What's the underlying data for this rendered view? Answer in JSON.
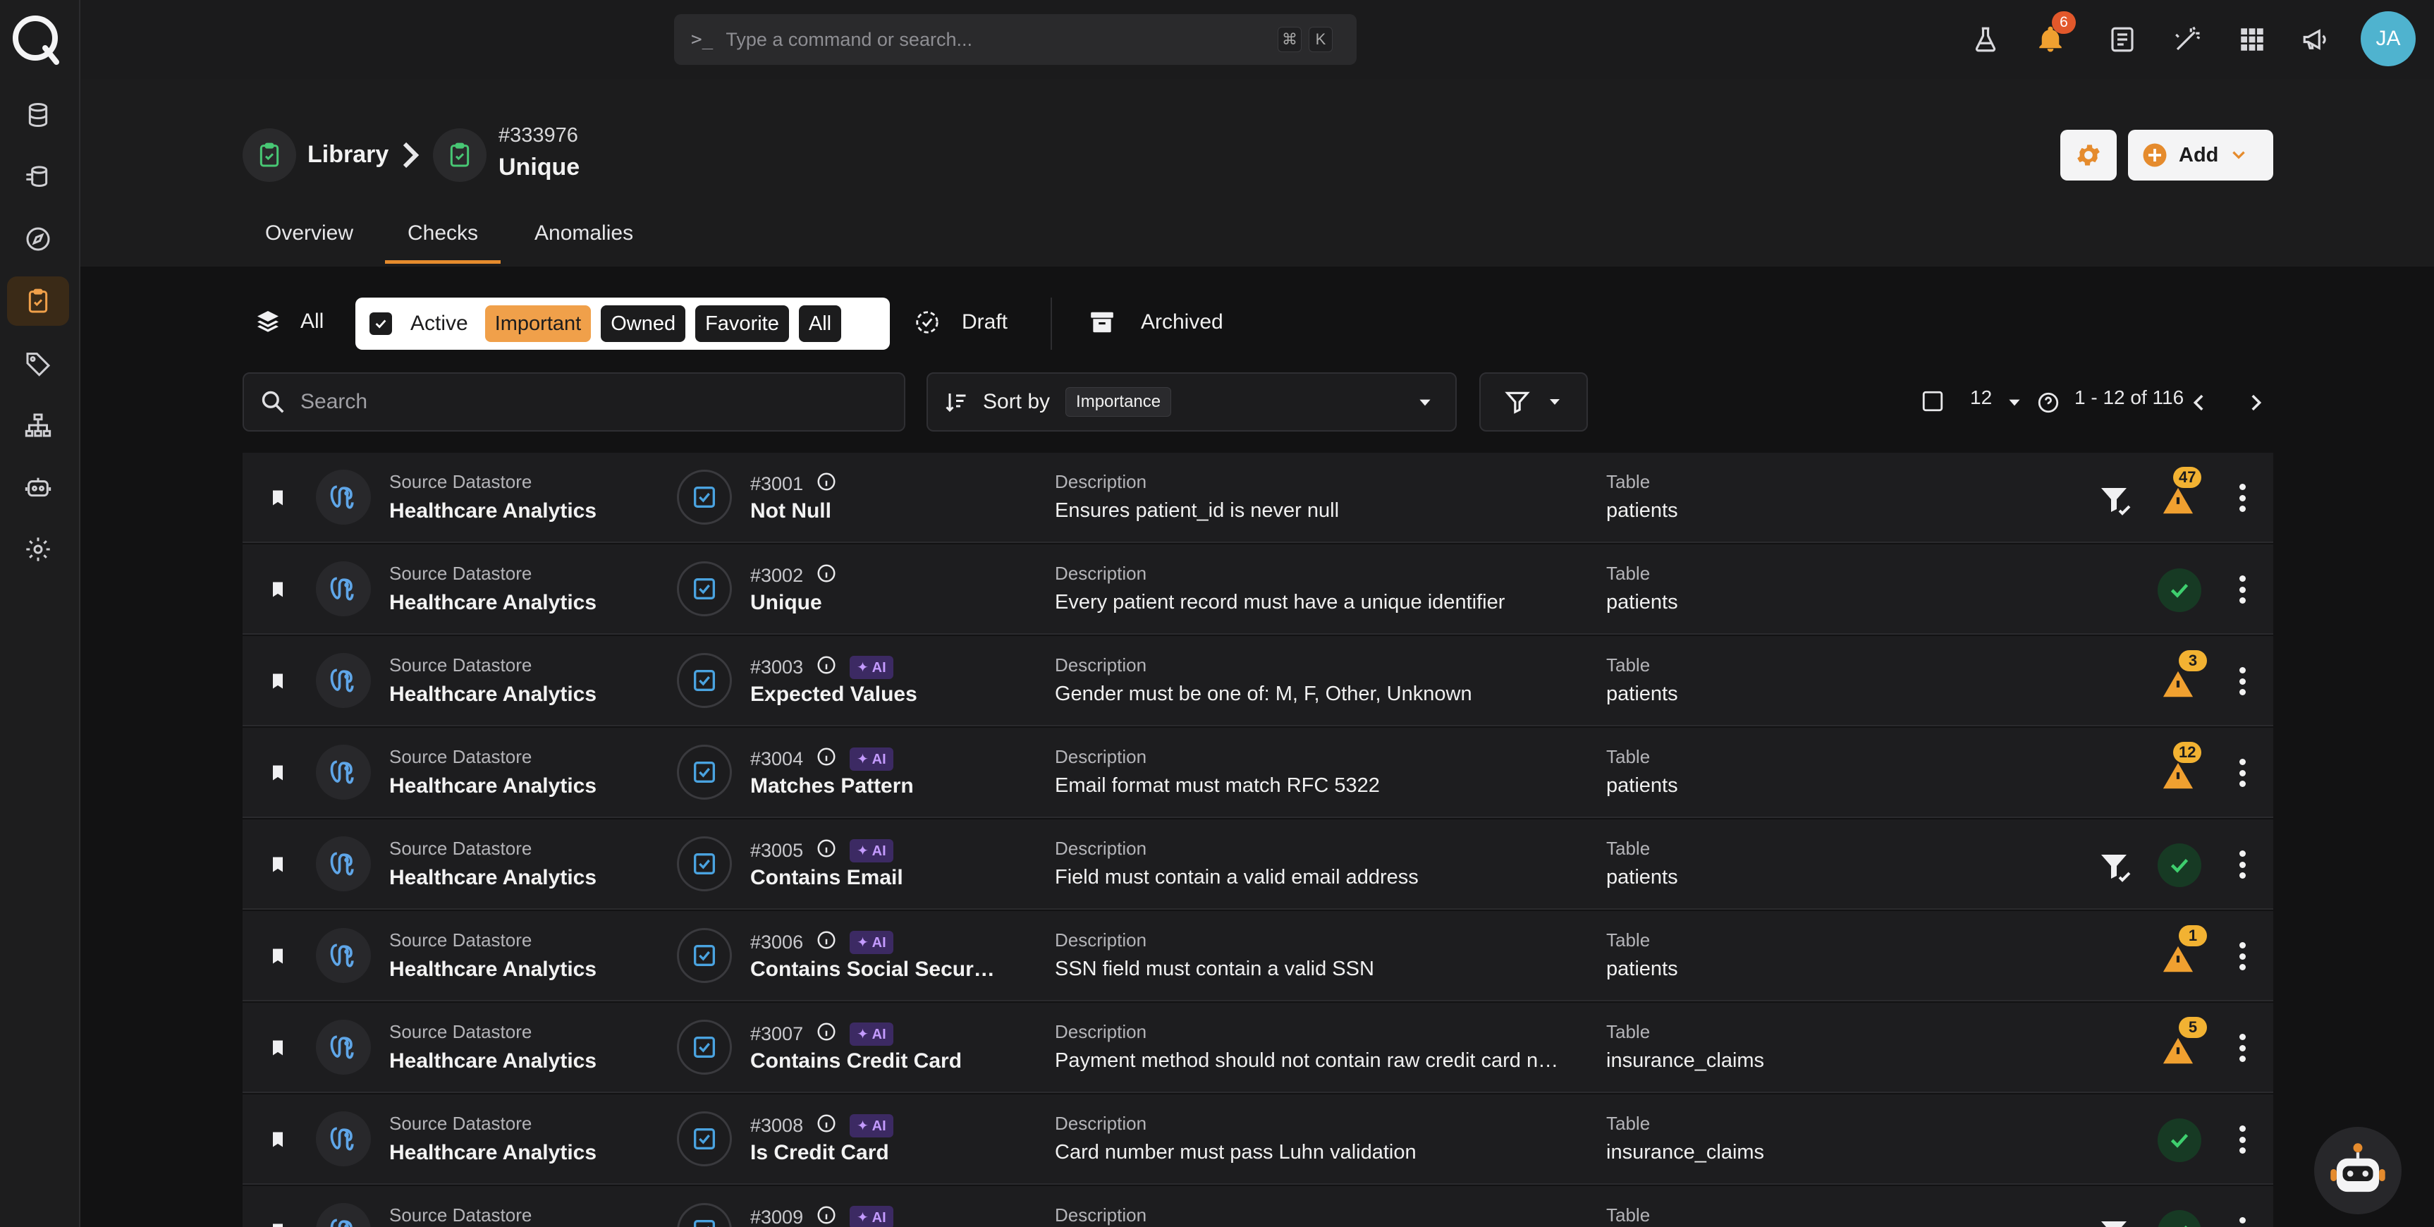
{
  "search_bar": {
    "placeholder": "Type a command or search...",
    "kbd1": "⌘",
    "kbd2": "K"
  },
  "notifications": {
    "count": "6"
  },
  "user": {
    "initials": "JA"
  },
  "breadcrumb": {
    "library": "Library",
    "check_id": "#333976",
    "check_name": "Unique"
  },
  "actions": {
    "add_label": "Add"
  },
  "tabs": [
    "Overview",
    "Checks",
    "Anomalies"
  ],
  "filters": {
    "all_label": "All",
    "active_label": "Active",
    "pills": [
      "Important",
      "Owned",
      "Favorite",
      "All"
    ],
    "draft_label": "Draft",
    "archived_label": "Archived"
  },
  "list_controls": {
    "search_placeholder": "Search",
    "sort_label": "Sort by",
    "sort_value": "Importance",
    "page_size": "12",
    "range": "1 - 12 of 116"
  },
  "columns": {
    "datastore": "Source Datastore",
    "description": "Description",
    "table": "Table"
  },
  "rows": [
    {
      "datastore": "Healthcare Analytics",
      "id": "#3001",
      "ai": false,
      "name": "Not Null",
      "description": "Ensures patient_id is never null",
      "table": "patients",
      "filter": true,
      "status": "warn",
      "count": "47"
    },
    {
      "datastore": "Healthcare Analytics",
      "id": "#3002",
      "ai": false,
      "name": "Unique",
      "description": "Every patient record must have a unique identifier",
      "table": "patients",
      "filter": false,
      "status": "ok",
      "count": ""
    },
    {
      "datastore": "Healthcare Analytics",
      "id": "#3003",
      "ai": true,
      "name": "Expected Values",
      "description": "Gender must be one of: M, F, Other, Unknown",
      "table": "patients",
      "filter": false,
      "status": "warn",
      "count": "3"
    },
    {
      "datastore": "Healthcare Analytics",
      "id": "#3004",
      "ai": true,
      "name": "Matches Pattern",
      "description": "Email format must match RFC 5322",
      "table": "patients",
      "filter": false,
      "status": "warn",
      "count": "12"
    },
    {
      "datastore": "Healthcare Analytics",
      "id": "#3005",
      "ai": true,
      "name": "Contains Email",
      "description": "Field must contain a valid email address",
      "table": "patients",
      "filter": true,
      "status": "ok",
      "count": ""
    },
    {
      "datastore": "Healthcare Analytics",
      "id": "#3006",
      "ai": true,
      "name": "Contains Social Security Number",
      "description": "SSN field must contain a valid SSN",
      "table": "patients",
      "filter": false,
      "status": "warn",
      "count": "1"
    },
    {
      "datastore": "Healthcare Analytics",
      "id": "#3007",
      "ai": true,
      "name": "Contains Credit Card",
      "description": "Payment method should not contain raw credit card numbers",
      "table": "insurance_claims",
      "filter": false,
      "status": "warn",
      "count": "5"
    },
    {
      "datastore": "Healthcare Analytics",
      "id": "#3008",
      "ai": true,
      "name": "Is Credit Card",
      "description": "Card number must pass Luhn validation",
      "table": "insurance_claims",
      "filter": false,
      "status": "ok",
      "count": ""
    },
    {
      "datastore": "",
      "id": "#3009",
      "ai": true,
      "name": "",
      "description": "",
      "table": "",
      "filter": true,
      "status": "ok",
      "count": ""
    }
  ],
  "ai_label": "AI",
  "colors": {
    "accent": "#e58b2d",
    "ok": "#3ecf6e",
    "warn": "#f0a030",
    "ai": "#c49bff"
  }
}
